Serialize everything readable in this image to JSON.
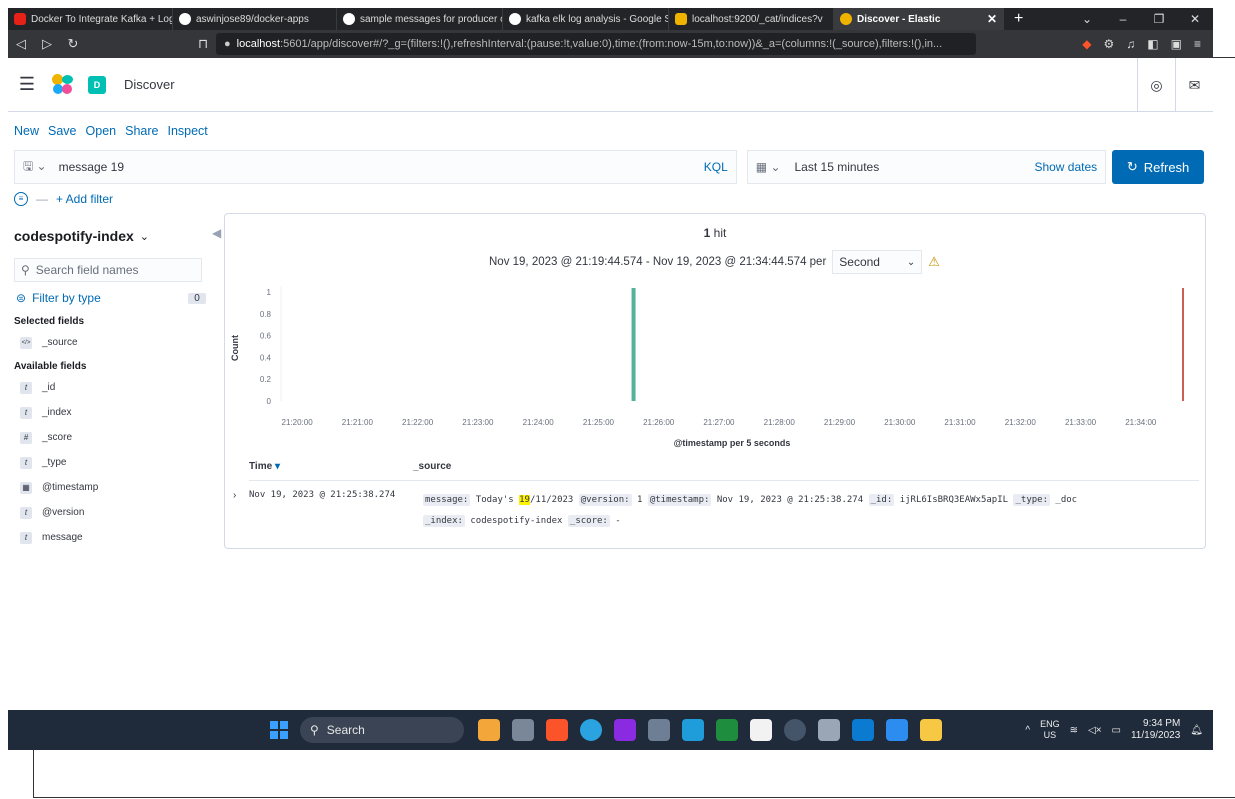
{
  "browser": {
    "tabs": [
      {
        "label": "Docker To Integrate Kafka + Logs",
        "color": "#e62117"
      },
      {
        "label": "aswinjose89/docker-apps",
        "color": "#ffffff"
      },
      {
        "label": "sample messages for producer c",
        "color": "#ffffff"
      },
      {
        "label": "kafka elk log analysis - Google S",
        "color": "#ffffff"
      },
      {
        "label": "localhost:9200/_cat/indices?v",
        "color": "#f0b400"
      },
      {
        "label": "Discover - Elastic",
        "color": "#f0b400"
      }
    ],
    "url_host": "localhost",
    "url_rest": ":5601/app/discover#/?_g=(filters:!(),refreshInterval:(pause:!t,value:0),time:(from:now-15m,to:now))&_a=(columns:!(_source),filters:!(),in..."
  },
  "header": {
    "space_initial": "D",
    "app_title": "Discover"
  },
  "top_nav": [
    "New",
    "Save",
    "Open",
    "Share",
    "Inspect"
  ],
  "query": {
    "value": "message 19",
    "language": "KQL"
  },
  "time": {
    "label": "Last 15 minutes",
    "show_dates": "Show dates",
    "refresh": "Refresh"
  },
  "filter": {
    "add_filter": "+ Add filter"
  },
  "sidebar": {
    "index_pattern": "codespotify-index",
    "search_placeholder": "Search field names",
    "filter_by_type": "Filter by type",
    "filter_count": "0",
    "selected_title": "Selected fields",
    "selected_fields": [
      {
        "type": "</>",
        "name": "_source"
      }
    ],
    "available_title": "Available fields",
    "available_fields": [
      {
        "type": "t",
        "name": "_id"
      },
      {
        "type": "t",
        "name": "_index"
      },
      {
        "type": "#",
        "name": "_score"
      },
      {
        "type": "t",
        "name": "_type"
      },
      {
        "type": "▦",
        "name": "@timestamp"
      },
      {
        "type": "t",
        "name": "@version"
      },
      {
        "type": "t",
        "name": "message"
      }
    ]
  },
  "results": {
    "hits_count": "1",
    "hits_label": "hit",
    "range": "Nov 19, 2023 @ 21:19:44.574 - Nov 19, 2023 @ 21:34:44.574 per",
    "interval": "Second",
    "col_time": "Time",
    "col_source": "_source",
    "doc": {
      "time": "Nov 19, 2023 @ 21:25:38.274",
      "message_key": "message:",
      "message_pre": "Today's ",
      "message_hl": "19",
      "message_post": "/11/2023",
      "version_key": "@version:",
      "version_val": "1",
      "timestamp_key": "@timestamp:",
      "timestamp_val": "Nov 19, 2023 @ 21:25:38.274",
      "id_key": "_id:",
      "id_val": "ijRL6IsBRQ3EAWx5apIL",
      "type_key": "_type:",
      "type_val": "_doc",
      "index_key": "_index:",
      "index_val": "codespotify-index",
      "score_key": "_score:",
      "score_val": "-"
    }
  },
  "chart_data": {
    "type": "bar",
    "title": "",
    "xlabel": "@timestamp per 5 seconds",
    "ylabel": "Count",
    "ylim": [
      0,
      1
    ],
    "y_ticks": [
      "1",
      "0.8",
      "0.6",
      "0.4",
      "0.2",
      "0"
    ],
    "x_ticks": [
      "21:20:00",
      "21:21:00",
      "21:22:00",
      "21:23:00",
      "21:24:00",
      "21:25:00",
      "21:26:00",
      "21:27:00",
      "21:28:00",
      "21:29:00",
      "21:30:00",
      "21:31:00",
      "21:32:00",
      "21:33:00",
      "21:34:00"
    ],
    "x_range": [
      "21:19:44",
      "21:34:44"
    ],
    "bars": [
      {
        "x": "21:25:35",
        "value": 1
      }
    ],
    "now_marker": "21:34:44",
    "bar_color": "#54b399",
    "marker_color": "#bd271e"
  },
  "taskbar": {
    "search": "Search",
    "lang_top": "ENG",
    "lang_bottom": "US",
    "time": "9:34 PM",
    "date": "11/19/2023"
  }
}
